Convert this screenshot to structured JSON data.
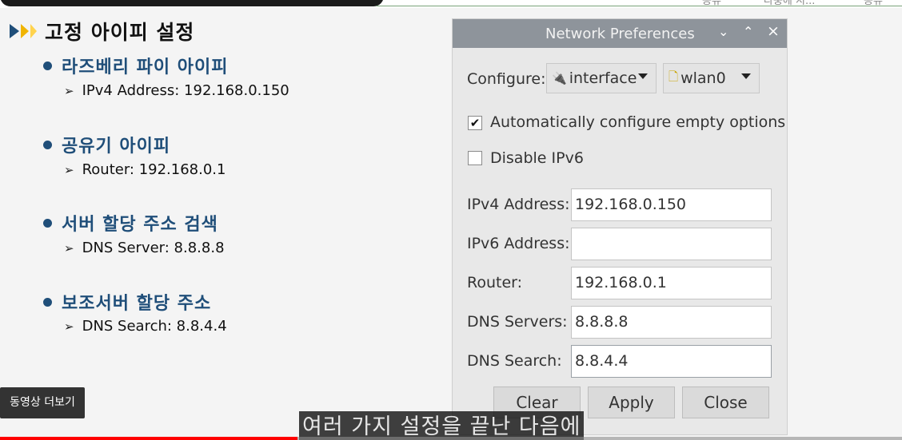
{
  "slide": {
    "title": "고정 아이피 설정",
    "sections": [
      {
        "heading": "라즈베리 파이 아이피",
        "detail": "IPv4 Address: 192.168.0.150"
      },
      {
        "heading": "공유기 아이피",
        "detail": "Router: 192.168.0.1"
      },
      {
        "heading": "서버 할당 주소 검색",
        "detail": "DNS Server: 8.8.8.8"
      },
      {
        "heading": "보조서버 할당 주소",
        "detail": "DNS Search: 8.8.4.4"
      }
    ]
  },
  "top_cut": {
    "left": "공유",
    "mid": "나중에 시...",
    "right": "공유"
  },
  "dialog": {
    "title": "Network Preferences",
    "window_buttons": {
      "minimize": "⌄",
      "maximize": "⌃",
      "close": "×"
    },
    "configure_label": "Configure:",
    "configure_type": "interface",
    "configure_type_icon": "plug-icon",
    "configure_target": "wlan0",
    "configure_target_icon": "network-device-icon",
    "auto_configure": {
      "label": "Automatically configure empty options",
      "checked": true,
      "mark": "✔"
    },
    "disable_ipv6": {
      "label": "Disable IPv6",
      "checked": false,
      "mark": ""
    },
    "fields": {
      "ipv4": {
        "label": "IPv4 Address:",
        "value": "192.168.0.150"
      },
      "ipv6": {
        "label": "IPv6 Address:",
        "value": ""
      },
      "router": {
        "label": "Router:",
        "value": "192.168.0.1"
      },
      "dns_servers": {
        "label": "DNS Servers:",
        "value": "8.8.8.8"
      },
      "dns_search": {
        "label": "DNS Search:",
        "value": "8.8.4.4"
      }
    },
    "buttons": {
      "clear": "Clear",
      "apply": "Apply",
      "close": "Close"
    }
  },
  "video": {
    "more_videos": "동영상 더보기",
    "caption": "여러 가지 설정을 끝난 다음에",
    "progress_fraction": 0.33
  },
  "colors": {
    "accent": "#1f4e79",
    "progress": "#ff0000",
    "titlebar": "#8e949b"
  }
}
